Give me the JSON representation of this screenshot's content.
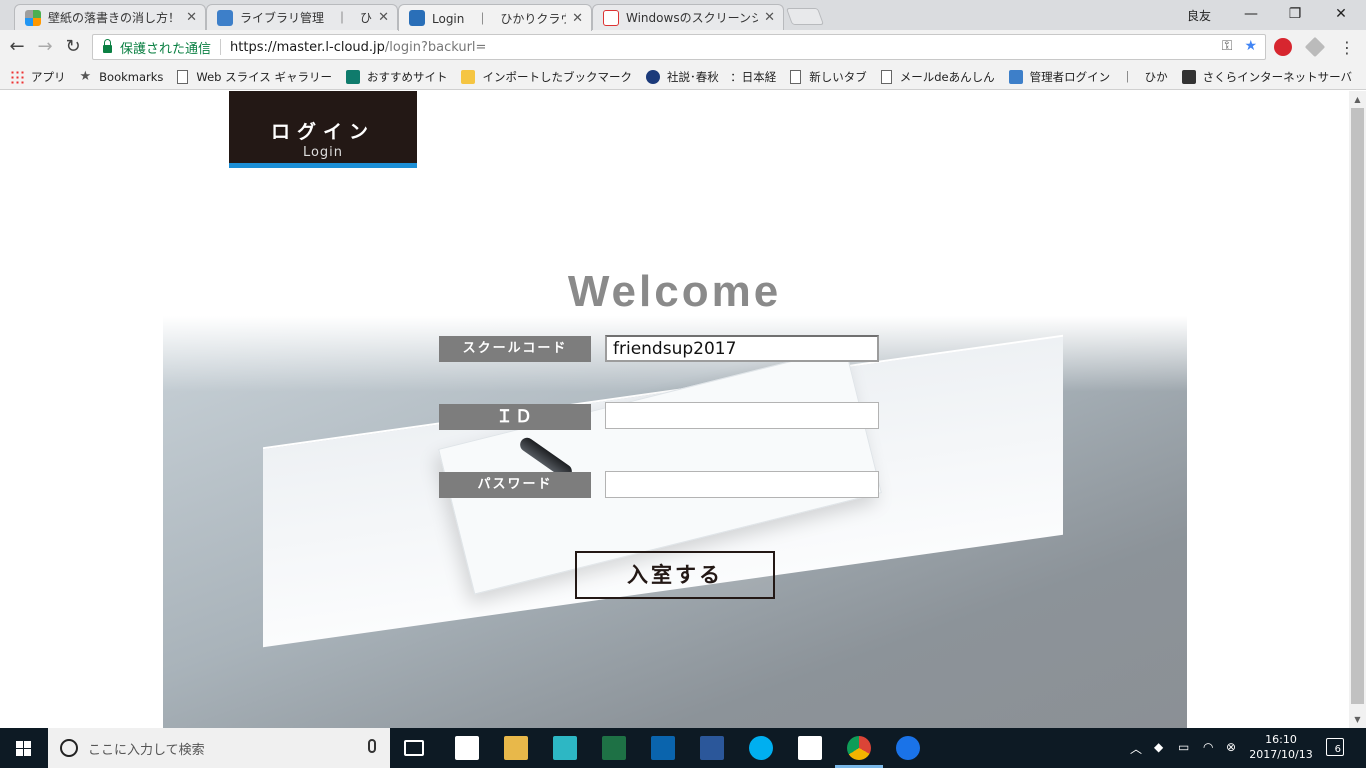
{
  "browser": {
    "tabs": [
      {
        "label": "壁紙の落書きの消し方！色"
      },
      {
        "label": "ライブラリ管理　｜　ひかりク"
      },
      {
        "label": "Login　｜　ひかりクラウド ス"
      },
      {
        "label": "Windowsのスクリーンショット"
      }
    ],
    "user": "良友",
    "window_controls": {
      "minimize": "—",
      "maximize": "❐",
      "close": "✕"
    },
    "security_label": "保護された通信",
    "url_host": "https://master.l-cloud.jp",
    "url_path": "/login?backurl=",
    "bookmarks": [
      "アプリ",
      "Bookmarks",
      "Web スライス ギャラリー",
      "おすすめサイト",
      "インポートしたブックマーク",
      "社説･春秋　：日本経",
      "新しいタブ",
      "メールdeあんしん",
      "管理者ログイン　｜　ひか",
      "さくらインターネットサーバ"
    ]
  },
  "page": {
    "header_jp": "ログイン",
    "header_en": "Login",
    "welcome": "Welcome",
    "fields": [
      {
        "label": "スクールコード",
        "value": "friendsup2017"
      },
      {
        "label": "ＩＤ",
        "value": ""
      },
      {
        "label": "パスワード",
        "value": ""
      }
    ],
    "submit_label": "入室する"
  },
  "taskbar": {
    "search_placeholder": "ここに入力して検索",
    "time": "16:10",
    "date": "2017/10/13",
    "notification_count": "6"
  },
  "colors": {
    "header_bg": "#231815",
    "header_accent": "#1c8fd6",
    "label_bg": "#7d7d7d",
    "welcome_text": "#8a8a8a",
    "secure_green": "#0b8043"
  }
}
